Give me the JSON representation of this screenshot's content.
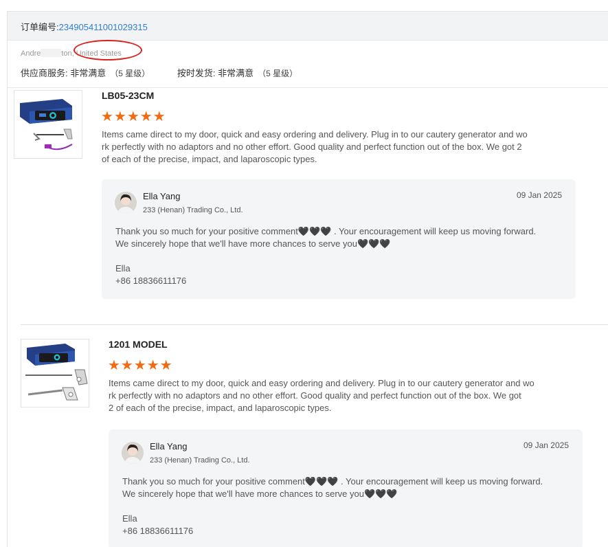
{
  "order": {
    "label": "订单编号:",
    "number": "234905411001029315"
  },
  "buyer": {
    "name_visible": "Andre",
    "name_suffix": "ton,",
    "country": "United States"
  },
  "ratings": {
    "supplier_label": "供应商服务:",
    "supplier_value": "非常满意",
    "supplier_stars": "（5 星级）",
    "shipping_label": "按时发货:",
    "shipping_value": "非常满意",
    "shipping_stars": "（5 星级）"
  },
  "colors": {
    "accent_link": "#2f7fd1",
    "star": "#f36a11",
    "highlight_circle": "#d9201d"
  },
  "reviews": [
    {
      "product": "LB05-23CM",
      "stars": "★★★★★",
      "rating": 5,
      "text": "Items came direct to my door, quick and easy ordering and delivery. Plug in to our cautery generator and wo\nrk perfectly with no adaptors and no other effort. Good quality and perfect function out of the box. We got 2\nof each of the precise, impact, and laparoscopic types.",
      "reply": {
        "seller_name": "Ella Yang",
        "company": "233 (Henan) Trading Co., Ltd.",
        "date": "09 Jan 2025",
        "text": "Thank you so much  for your positive comment🖤🖤🖤 . Your encouragement will keep us moving forward.\nWe sincerely hope that we'll have more chances to serve you🖤🖤🖤",
        "signature": "Ella\n+86 18836611176"
      }
    },
    {
      "product": "1201 MODEL",
      "stars": "★★★★★",
      "rating": 5,
      "text": "Items came direct to my door, quick and easy ordering and delivery. Plug in to our cautery generator and wo\nrk perfectly with no adaptors and no other effort. Good quality and perfect function out of the box.  We got\n2 of each of the precise, impact, and laparoscopic types.",
      "reply": {
        "seller_name": "Ella Yang",
        "company": "233 (Henan) Trading Co., Ltd.",
        "date": "09 Jan 2025",
        "text": "Thank you so much  for your positive comment🖤🖤🖤 . Your encouragement will keep us moving forward.\nWe sincerely hope that we'll have more chances to serve you🖤🖤🖤",
        "signature": "Ella\n+86 18836611176"
      }
    }
  ]
}
